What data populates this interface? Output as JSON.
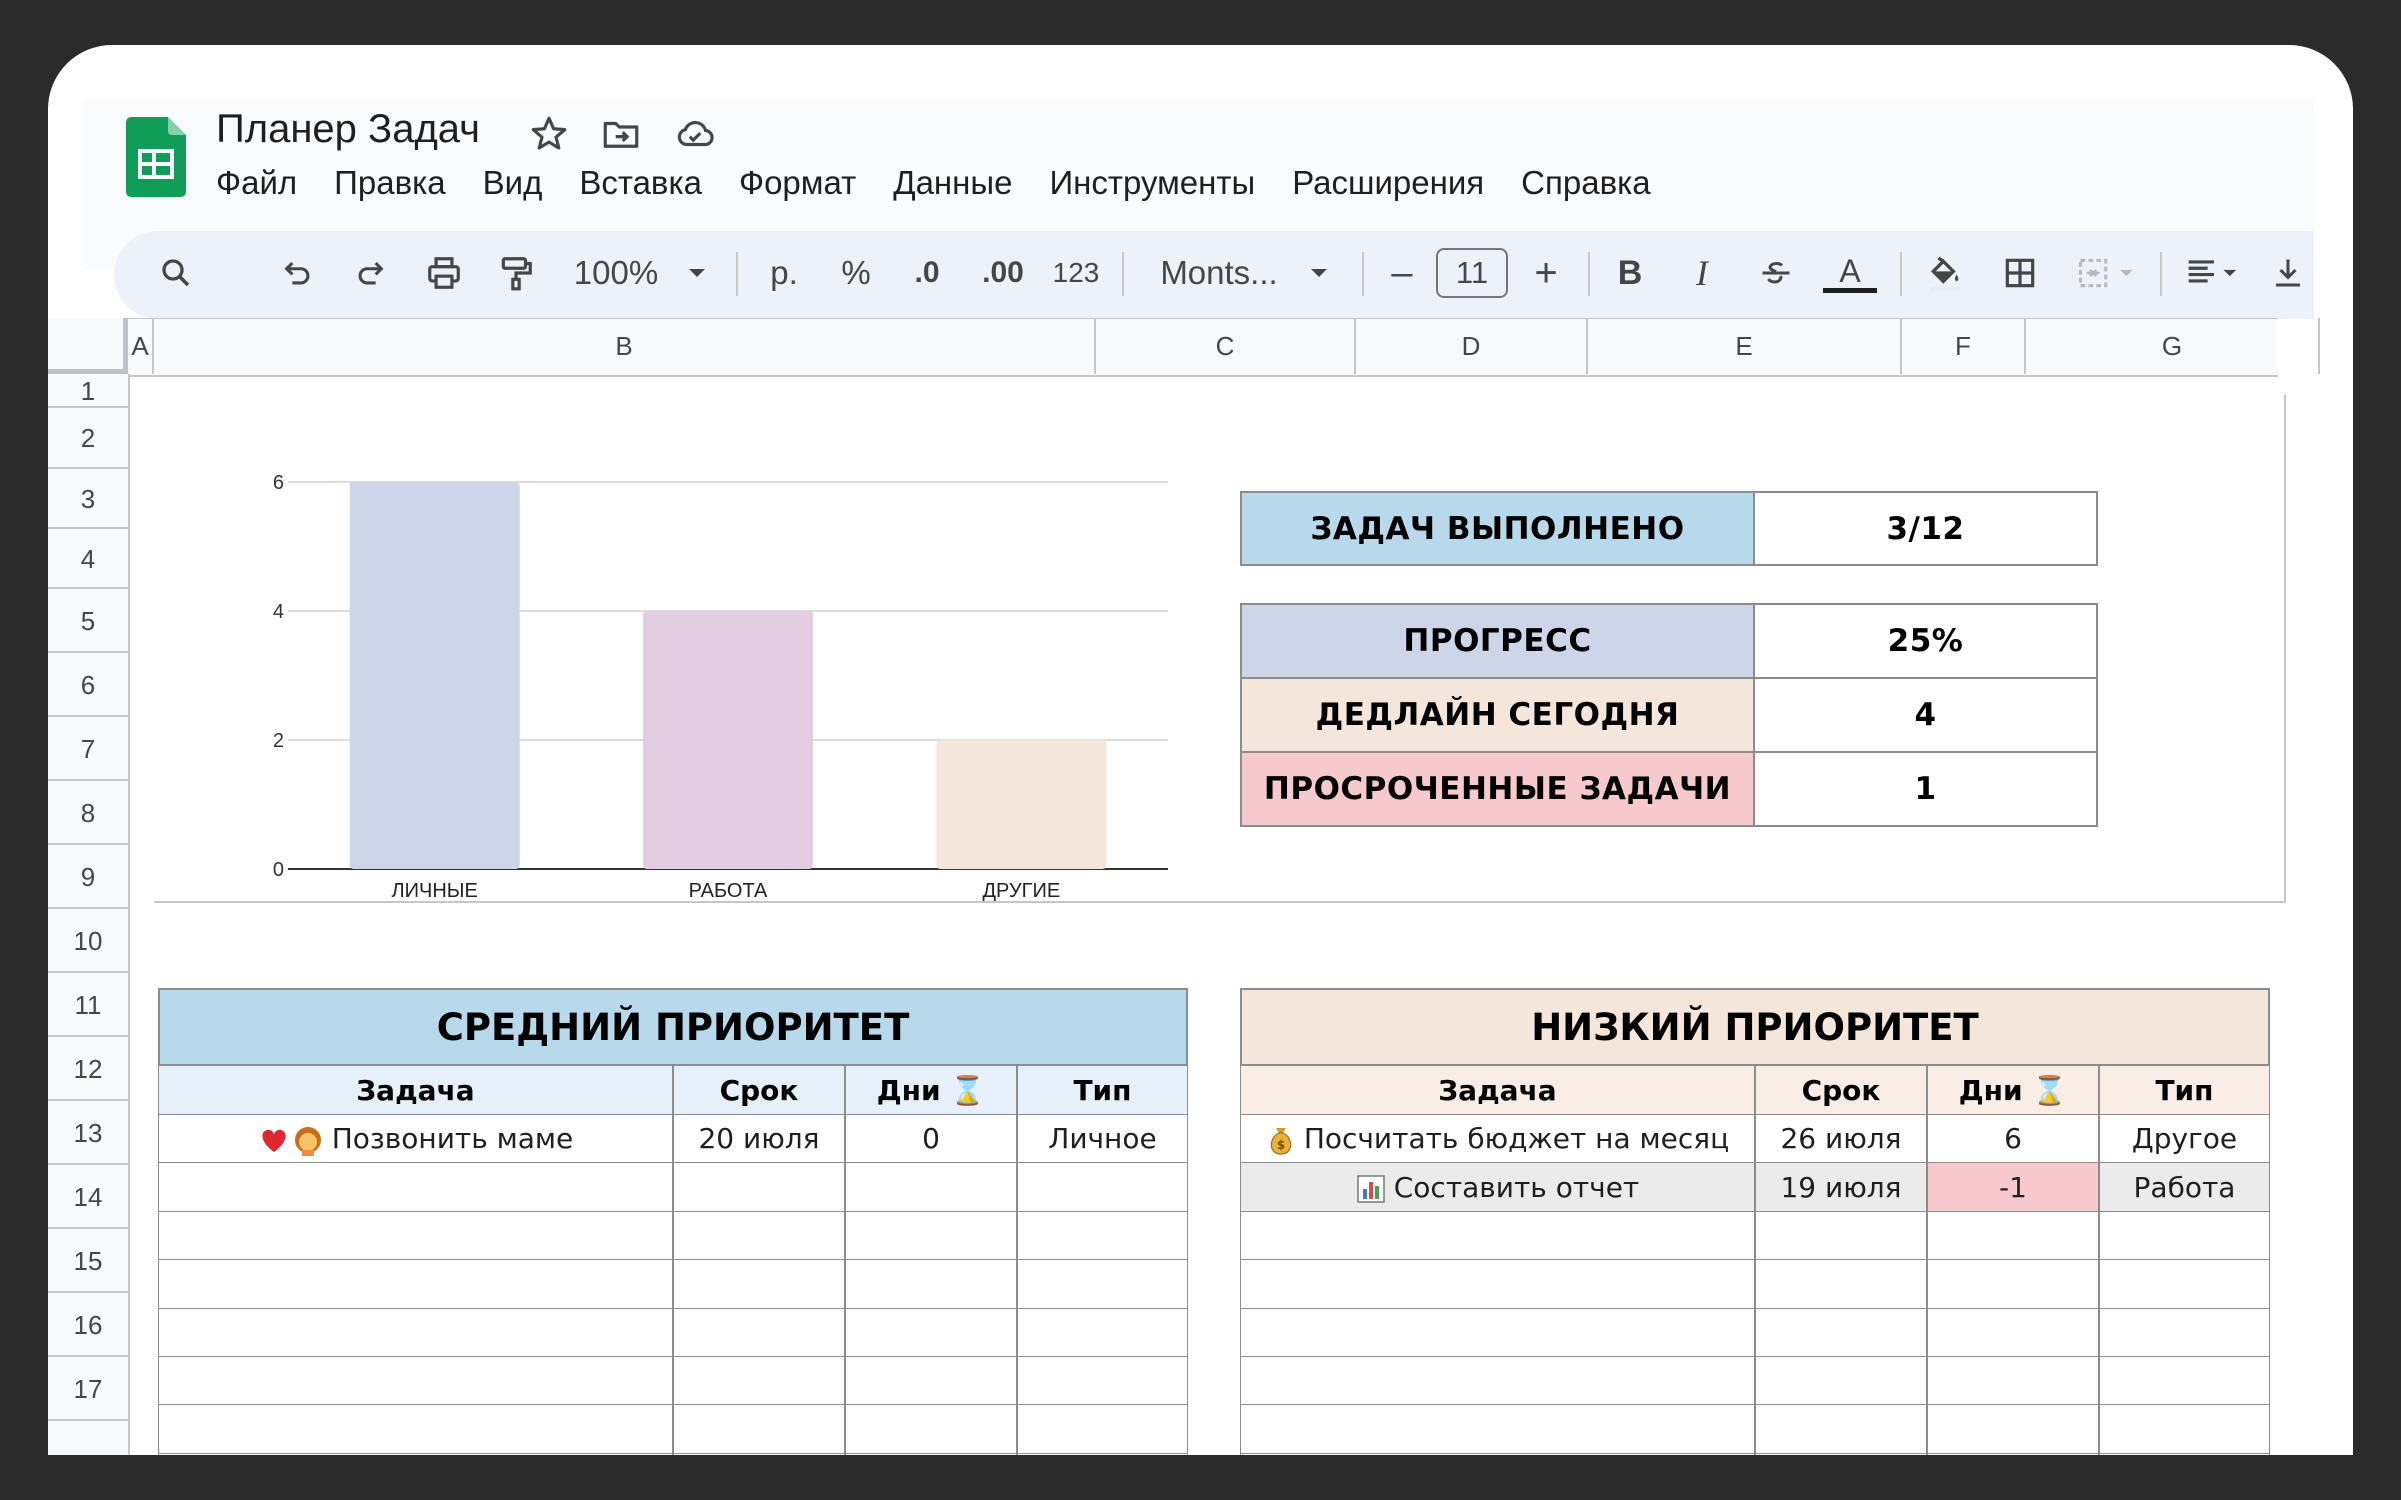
{
  "app": {
    "title": "Планер Задач",
    "menu": [
      "Файл",
      "Правка",
      "Вид",
      "Вставка",
      "Формат",
      "Данные",
      "Инструменты",
      "Расширения",
      "Справка"
    ]
  },
  "toolbar": {
    "zoom": "100%",
    "currency": "р.",
    "percent": "%",
    "dec_less": ".0",
    "dec_more": ".00",
    "num_format": "123",
    "font": "Monts...",
    "font_size": "11",
    "minus": "–",
    "plus": "+",
    "bold": "B",
    "italic": "I",
    "text_color": "A"
  },
  "columns": [
    "A",
    "B",
    "C",
    "D",
    "E",
    "F",
    "G"
  ],
  "rows": [
    "1",
    "2",
    "3",
    "4",
    "5",
    "6",
    "7",
    "8",
    "9",
    "10",
    "11",
    "12",
    "13",
    "14",
    "15",
    "16",
    "17"
  ],
  "chart_data": {
    "type": "bar",
    "categories": [
      "ЛИЧНЫЕ",
      "РАБОТА",
      "ДРУГИЕ"
    ],
    "values": [
      6,
      4,
      2
    ],
    "colors": [
      "#cdd6e8",
      "#e2cde3",
      "#f5e6dc"
    ],
    "ylim": [
      0,
      6
    ],
    "yticks": [
      "0",
      "2",
      "4",
      "6"
    ],
    "grid": true,
    "title": "",
    "xlabel": "",
    "ylabel": ""
  },
  "stats": [
    {
      "label": "ЗАДАЧ ВЫПОЛНЕНО",
      "value": "3/12",
      "color": "#b8d9ec"
    },
    {
      "label": "ПРОГРЕСС",
      "value": "25%",
      "color": "#cdd6e8"
    },
    {
      "label": "ДЕДЛАЙН СЕГОДНЯ",
      "value": "4",
      "color": "#f5e6dc"
    },
    {
      "label": "ПРОСРОЧЕННЫЕ ЗАДАЧИ",
      "value": "1",
      "color": "#f6c9cd"
    }
  ],
  "medium": {
    "title": "СРЕДНИЙ ПРИОРИТЕТ",
    "title_color": "#b8d9ec",
    "head_color": "#e5f0fa",
    "headers": [
      "Задача",
      "Срок",
      "Дни ⌛",
      "Тип"
    ],
    "rows": [
      {
        "task": "Позвонить маме",
        "icon": "heart-woman",
        "date": "20 июля",
        "days": "0",
        "type": "Личное"
      }
    ]
  },
  "low": {
    "title": "НИЗКИЙ ПРИОРИТЕТ",
    "title_color": "#f5e6dc",
    "head_color": "#f9ede5",
    "headers": [
      "Задача",
      "Срок",
      "Дни ⌛",
      "Тип"
    ],
    "rows": [
      {
        "task": "Посчитать бюджет на месяц",
        "icon": "money-bag",
        "date": "26 июля",
        "days": "6",
        "type": "Другое"
      },
      {
        "task": "Составить отчет",
        "icon": "bar-chart",
        "date": "19 июля",
        "days": "-1",
        "type": "Работа"
      }
    ]
  }
}
